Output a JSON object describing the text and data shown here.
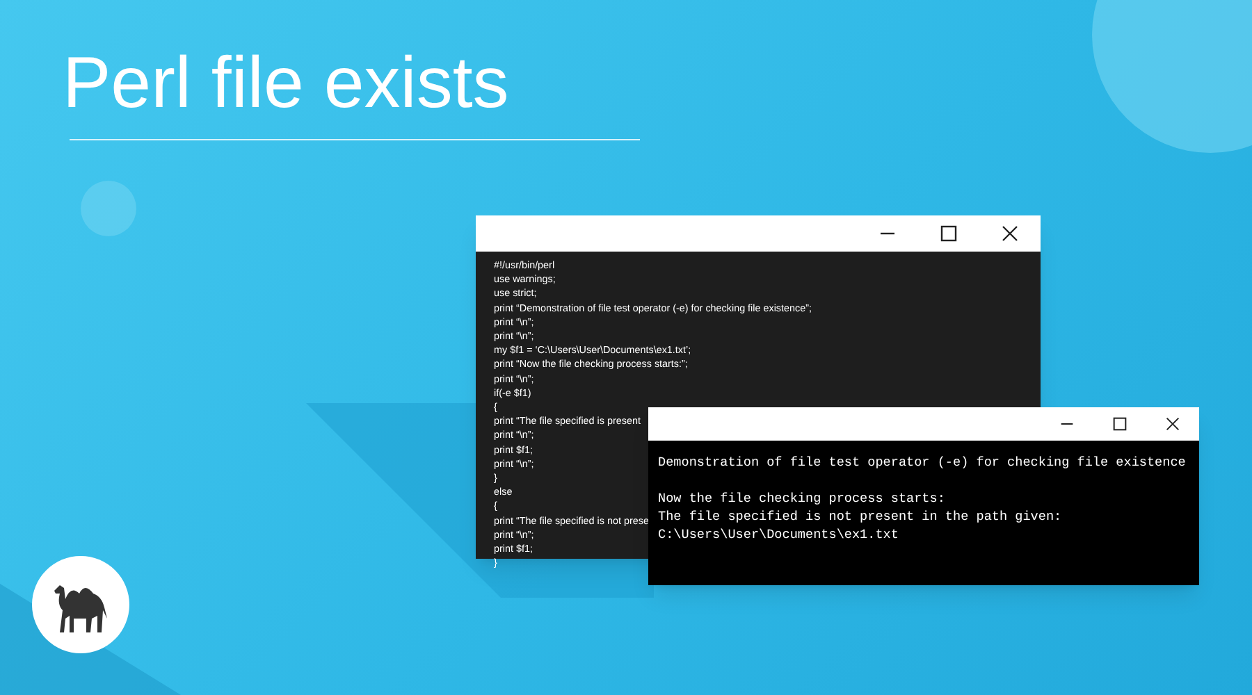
{
  "title": "Perl file exists",
  "code_window": {
    "lines": [
      "#!/usr/bin/perl",
      "use warnings;",
      "use strict;",
      "print “Demonstration of file test operator (-e) for checking file existence”;",
      "print “\\n”;",
      "print “\\n”;",
      "my $f1 = ‘C:\\Users\\User\\Documents\\ex1.txt’;",
      "print “Now the file checking process starts:”;",
      "print “\\n”;",
      "if(-e $f1)",
      "{",
      "print “The file specified is present",
      "print “\\n”;",
      "print $f1;",
      "print “\\n”;",
      "}",
      "else",
      "{",
      "print “The file specified is not prese",
      "print “\\n”;",
      "print $f1;",
      "}"
    ]
  },
  "output_window": {
    "blocks": [
      [
        "Demonstration of file test operator (-e) for checking file existence"
      ],
      [
        "Now the file checking process starts:",
        "The file specified is not present in the path given:",
        "C:\\Users\\User\\Documents\\ex1.txt"
      ]
    ]
  }
}
